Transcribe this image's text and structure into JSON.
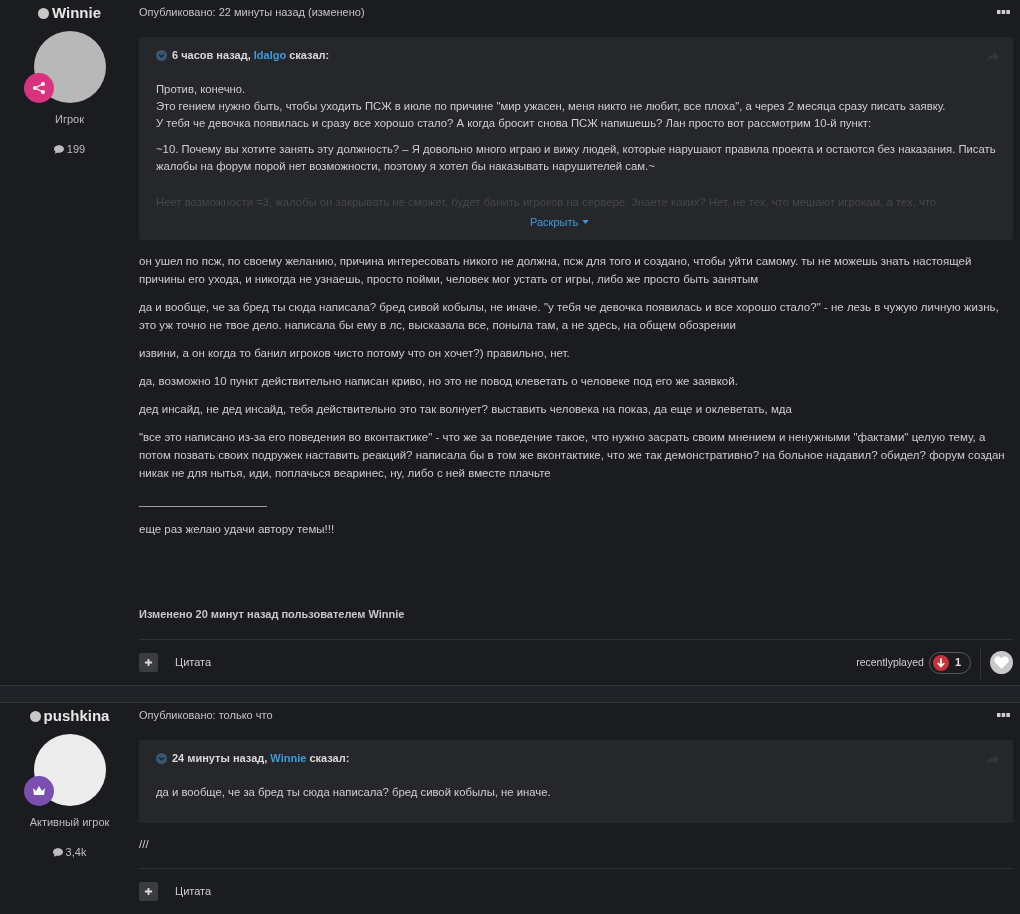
{
  "posts": [
    {
      "author": "Winnie",
      "rank": "Игрок",
      "post_count": "199",
      "badge": {
        "kind": "share"
      },
      "posted": "Опубликовано: 22 минуты назад (изменено)",
      "quote": {
        "time": "6 часов назад,",
        "author": "Idalgo",
        "verb": "сказал:",
        "paragraphs": [
          "Против, конечно.\nЭто гением нужно быть, чтобы уходить ПСЖ в июле по причине \"мир ужасен, меня никто не любит, все плоха\", а через 2 месяца сразу писать заявку.\nУ тебя че девочка появилась и сразу все хорошо стало? А когда бросит снова ПСЖ напишешь?  Лан просто вот рассмотрим 10-й пункт:",
          "~10. Почему вы хотите занять эту должность? – Я довольно много играю и вижу людей, которые нарушают правила проекта и остаются без наказания. Писать жалобы на форум порой нет возможности, поэтому я хотел бы наказывать нарушителей сам.~"
        ],
        "faded_text": "Неет возможности =3, жалобы он закрывать не сможет, будет банить игроков на сервере. Знаете каких? Нет, не тех, что мешают игрокам, а тех, что",
        "expand_label": "Раскрыть"
      },
      "paragraphs": [
        "он ушел по псж, по своему желанию, причина интересовать никого не должна, псж для того и создано, чтобы уйти самому. ты не можешь знать настоящей причины его ухода, и никогда не узнаешь, просто пойми, человек мог устать от игры, либо же просто быть занятым",
        "да и вообще, че за бред ты сюда написала? бред сивой кобылы, не иначе. \"у тебя че девочка появилась и все хорошо стало?\" - не лезь в чужую личную жизнь, это уж точно не твое дело. написала бы ему в лс, высказала все, поныла там, а не здесь, на общем обозрении",
        "извини, а он когда то банил игроков чисто потому что он хочет?) правильно, нет.",
        "да, возможно 10 пункт действительно написан криво, но это не повод клеветать о человеке под его же заявкой.",
        "дед инсайд, не дед инсайд, тебя действительно это так волнует? выставить человека на показ, да еще и оклеветать, мда",
        "\"все это написано из-за его поведения во вконтактике\" - что же за поведение такое, что нужно засрать своим мнением и ненужными \"фактами\" целую тему, а потом позвать своих подружек наставить реакций? написала бы в том же вконтактике, что же так демонстративно? на больное надавил? обидел? форум создан никак не для нытья, иди, поплачься веаринес, ну, либо с ней вместе плачьте",
        "____________________",
        "еще раз желаю удачи автору темы!!!"
      ],
      "edited_note": "Изменено 20 минут назад пользователем Winnie",
      "quote_action": "Цитата",
      "reaction": {
        "user": "recentlyplayed",
        "count": "1"
      }
    },
    {
      "author": "pushkina",
      "rank": "Активный игрок",
      "post_count": "3,4k",
      "badge": {
        "kind": "crown"
      },
      "posted": "Опубликовано: только что",
      "quote": {
        "time": "24 минуты назад,",
        "author": "Winnie",
        "verb": "сказал:",
        "paragraphs": [
          "да и вообще, че за бред ты сюда написала? бред сивой кобылы, не иначе."
        ]
      },
      "paragraphs": [
        "///"
      ],
      "quote_action": "Цитата"
    }
  ]
}
